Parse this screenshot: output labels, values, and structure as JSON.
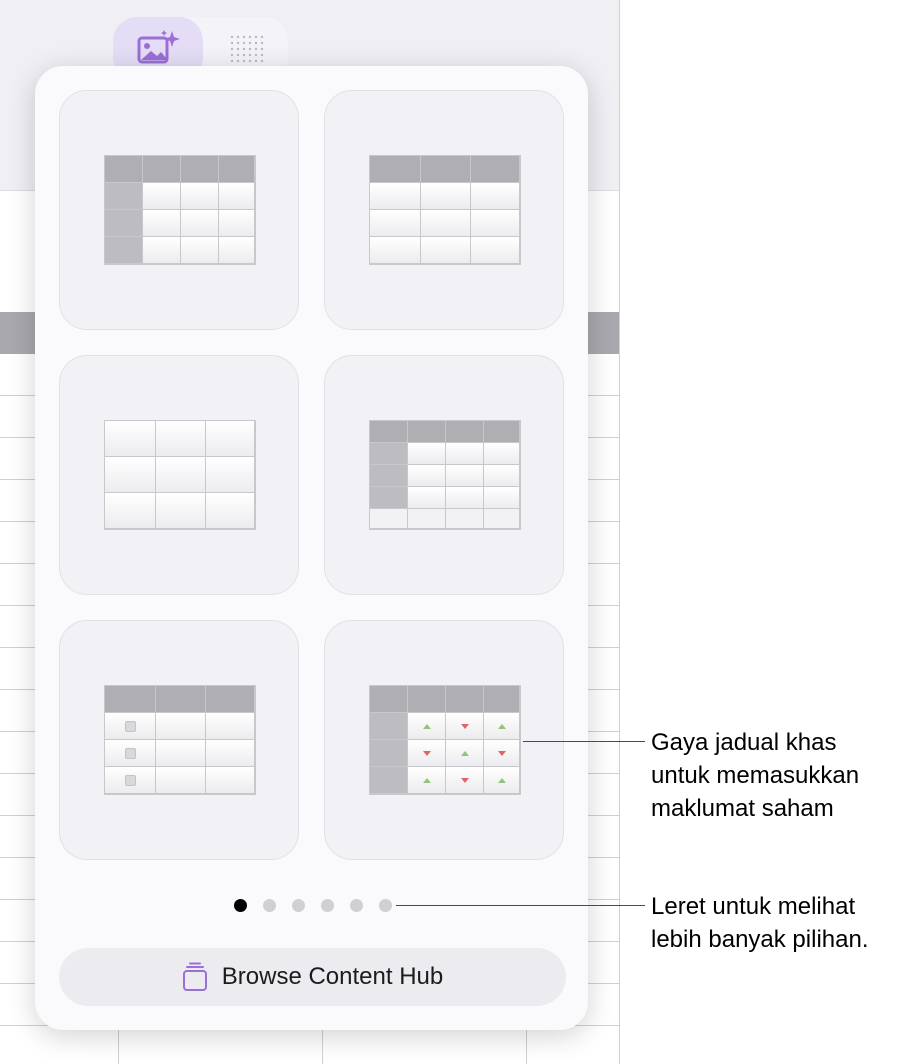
{
  "popover": {
    "tiles": [
      {
        "name": "table-style-header-row-column"
      },
      {
        "name": "table-style-header-row"
      },
      {
        "name": "table-style-plain"
      },
      {
        "name": "table-style-header-footer"
      },
      {
        "name": "table-style-checklist"
      },
      {
        "name": "table-style-stock"
      }
    ],
    "page_count": 6,
    "current_page": 1,
    "browse_button": {
      "label": "Browse Content Hub",
      "icon": "content-hub-icon"
    }
  },
  "tabs": [
    {
      "name": "media-tab",
      "icon": "image-sparkle-icon",
      "active": true
    },
    {
      "name": "tables-tab",
      "icon": "dot-grid-icon",
      "active": false
    }
  ],
  "callouts": {
    "stock": "Gaya jadual khas\nuntuk memasukkan\nmaklumat saham",
    "swipe": "Leret untuk melihat\nlebih banyak pilihan."
  },
  "colors": {
    "accent": "#9b6fd6",
    "header_cell": "#aeaeb3",
    "up_arrow": "#93c47d",
    "down_arrow": "#e06666"
  }
}
